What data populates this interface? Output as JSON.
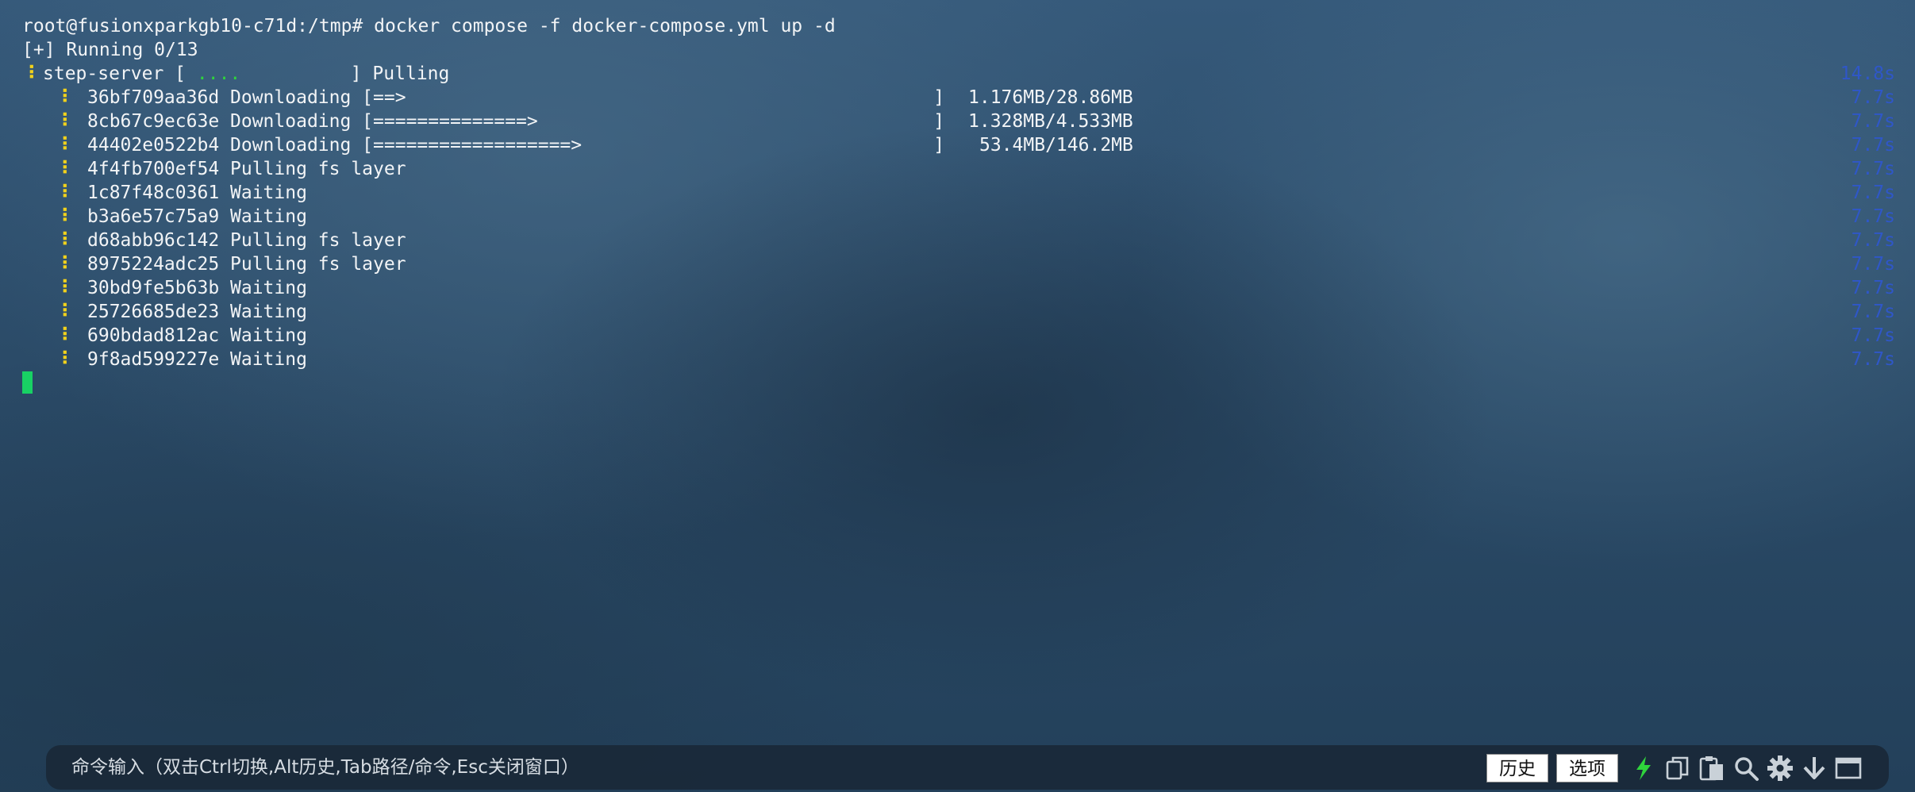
{
  "terminal": {
    "prompt_line": "root@fusionxparkgb10-c71d:/tmp# docker compose -f docker-compose.yml up -d",
    "running_line": "[+] Running 0/13",
    "service": {
      "spinner": "⠸",
      "name": "step-server",
      "bar_open": " [ ",
      "bar_dots": "....",
      "bar_close": "          ] Pulling",
      "time": "14.8s"
    },
    "layers": [
      {
        "spinner": "⠸",
        "text": "36bf709aa36d Downloading [==>                                                ]",
        "size": "1.176MB/28.86MB",
        "time": "7.7s"
      },
      {
        "spinner": "⠸",
        "text": "8cb67c9ec63e Downloading [==============>                                    ]",
        "size": "1.328MB/4.533MB",
        "time": "7.7s"
      },
      {
        "spinner": "⠸",
        "text": "44402e0522b4 Downloading [==================>                                ]",
        "size": "53.4MB/146.2MB",
        "time": "7.7s"
      },
      {
        "spinner": "⠸",
        "text": "4f4fb700ef54 Pulling fs layer",
        "size": "",
        "time": "7.7s"
      },
      {
        "spinner": "⠸",
        "text": "1c87f48c0361 Waiting",
        "size": "",
        "time": "7.7s"
      },
      {
        "spinner": "⠸",
        "text": "b3a6e57c75a9 Waiting",
        "size": "",
        "time": "7.7s"
      },
      {
        "spinner": "⠸",
        "text": "d68abb96c142 Pulling fs layer",
        "size": "",
        "time": "7.7s"
      },
      {
        "spinner": "⠸",
        "text": "8975224adc25 Pulling fs layer",
        "size": "",
        "time": "7.7s"
      },
      {
        "spinner": "⠸",
        "text": "30bd9fe5b63b Waiting",
        "size": "",
        "time": "7.7s"
      },
      {
        "spinner": "⠸",
        "text": "25726685de23 Waiting",
        "size": "",
        "time": "7.7s"
      },
      {
        "spinner": "⠸",
        "text": "690bdad812ac Waiting",
        "size": "",
        "time": "7.7s"
      },
      {
        "spinner": "⠸",
        "text": "9f8ad599227e Waiting",
        "size": "",
        "time": "7.7s"
      }
    ]
  },
  "command_bar": {
    "hint": "命令输入（双击Ctrl切换,Alt历史,Tab路径/命令,Esc关闭窗口）",
    "history_label": "历史",
    "options_label": "选项",
    "icons": [
      "lightning-icon",
      "copy-icon",
      "paste-icon",
      "search-icon",
      "gear-icon",
      "download-icon",
      "window-icon"
    ]
  },
  "colors": {
    "spinner": "#f2d21b",
    "progress_dots": "#2fd43c",
    "timer": "#2f57c8",
    "cursor": "#18d164",
    "lightning": "#2fd43c"
  }
}
